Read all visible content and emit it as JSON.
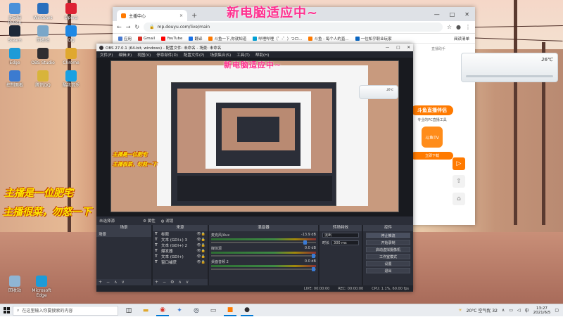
{
  "overlay": {
    "headline": "新电脑适应中~",
    "obs_headline": "新电脑适应中~",
    "yellow_line1": "主播是一位肥宅",
    "yellow_line2": "主播很菜，勿怒一下"
  },
  "ac_unit": {
    "label": "26℃",
    "small_label": "26℃"
  },
  "desktop_icons": [
    {
      "label": "此电脑 RyBen",
      "color": "#4a90d9"
    },
    {
      "label": "Windows",
      "color": "#2a6fbd"
    },
    {
      "label": "Opera",
      "color": "#d23"
    },
    {
      "label": "Steam",
      "color": "#1b2838"
    },
    {
      "label": "回收站",
      "color": "#7aa7c9"
    },
    {
      "label": "QQ",
      "color": "#1e88e5"
    },
    {
      "label": "Edge",
      "color": "#1d9bd7"
    },
    {
      "label": "OBS Studio",
      "color": "#302e31"
    },
    {
      "label": "Chrome",
      "color": "#e0a82e"
    },
    {
      "label": "控制面板",
      "color": "#3c7bd0"
    },
    {
      "label": "腾讯QQ",
      "color": "#d8b43a"
    },
    {
      "label": "酷我音乐",
      "color": "#1aa1e2"
    }
  ],
  "desktop_bottom_icons": [
    {
      "label": "回收站",
      "color": "#8fb5d4"
    },
    {
      "label": "Microsoft Edge",
      "color": "#1d9bd7"
    }
  ],
  "browser": {
    "tab_title": "主播中心",
    "url": "mp.douyu.com/live/main",
    "window_controls": [
      "—",
      "□",
      "✕"
    ],
    "bookmarks": [
      {
        "label": "应用",
        "color": "#4a7bd0"
      },
      {
        "label": "Gmail",
        "color": "#d93025"
      },
      {
        "label": "YouTube",
        "color": "#ff0000"
      },
      {
        "label": "翻译",
        "color": "#1a73e8"
      },
      {
        "label": "斗鱼一下,你就知道",
        "color": "#ff7a00"
      },
      {
        "label": "哔哩哔哩（゜-゜）つロ...",
        "color": "#00a1d6"
      },
      {
        "label": "斗鱼 - 每个人的直...",
        "color": "#ff7a00"
      },
      {
        "label": "一位知乎职业玩家",
        "color": "#0a66c2"
      }
    ],
    "reading_list": "阅读清单",
    "right_link": "直播助手"
  },
  "promo": {
    "heading": "斗鱼直播伴侣",
    "subtitle": "专业的PC直播工具",
    "logo_text": "斗鱼TV",
    "download": "立即下载"
  },
  "obs": {
    "title": "OBS 27.0.1 (64-bit, windows) - 配置文件: 未命名 - 场景: 未命名",
    "menu": [
      "文件(F)",
      "编辑(E)",
      "视图(V)",
      "停靠部件(D)",
      "配置文件(P)",
      "场景集合(S)",
      "工具(T)",
      "帮助(H)"
    ],
    "scene_bar_left": "未选择源",
    "scene_bar_props": "属性",
    "scene_bar_filters": "滤镜",
    "docks": {
      "scenes": {
        "title": "场景",
        "items": [
          "场景"
        ]
      },
      "sources": {
        "title": "来源",
        "items": [
          {
            "type": "T",
            "name": "标题"
          },
          {
            "type": "T",
            "name": "文本 (GDI+) 3"
          },
          {
            "type": "T",
            "name": "文本 (GDI+) 2"
          },
          {
            "type": "T",
            "name": "爆发器"
          },
          {
            "type": "T",
            "name": "文本 (GDI+)"
          },
          {
            "type": "T",
            "name": "窗口捕获"
          }
        ]
      },
      "mixer": {
        "title": "混音器",
        "channels": [
          {
            "name": "麦克风/Aux",
            "db": "-13.9 dB"
          },
          {
            "name": "媒体源",
            "db": "0.0 dB"
          },
          {
            "name": "桌面音频 2",
            "db": "0.0 dB"
          }
        ]
      },
      "transitions": {
        "title": "转场特效",
        "fade": "淡出",
        "duration_label": "时长",
        "duration_value": "300 ms"
      },
      "controls": {
        "title": "控件",
        "buttons": [
          "停止推流",
          "开始录制",
          "启动虚拟摄像机",
          "工作室模式",
          "设置",
          "退出"
        ]
      }
    },
    "status": {
      "live": "LIVE: 00:00:00",
      "rec": "REC: 00:00:00",
      "cpu": "CPU: 1.1%, 60.00 fps"
    }
  },
  "taskbar": {
    "search_placeholder": "在这里输入你要搜索的内容",
    "weather": "20°C 空气优 32",
    "ime": "中",
    "time": "13:27",
    "date": "2021/6/5"
  }
}
